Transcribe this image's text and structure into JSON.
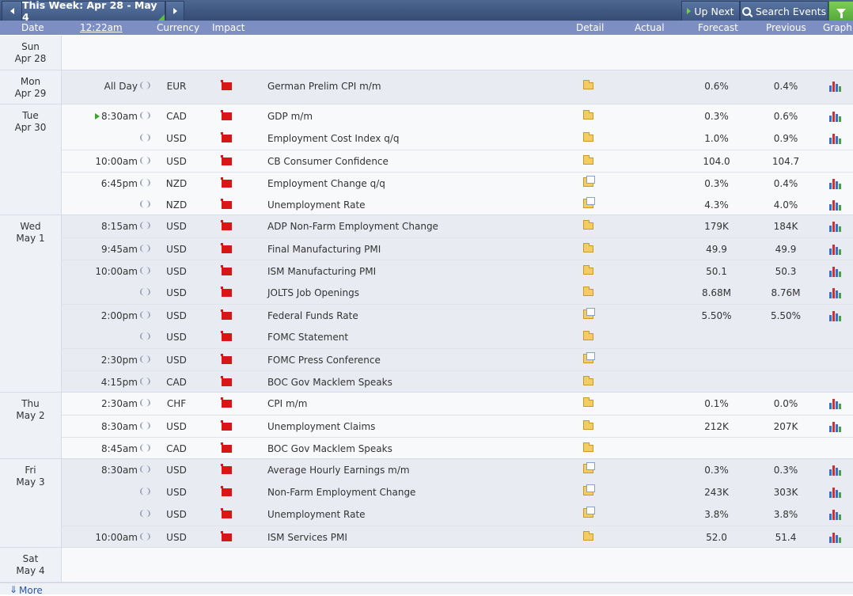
{
  "toolbar": {
    "week_label": "This Week: Apr 28 - May 4",
    "up_next": "Up Next",
    "search": "Search Events"
  },
  "header": {
    "date": "Date",
    "time": "12:22am",
    "currency": "Currency",
    "impact": "Impact",
    "detail": "Detail",
    "actual": "Actual",
    "forecast": "Forecast",
    "previous": "Previous",
    "graph": "Graph"
  },
  "days": [
    {
      "d1": "Sun",
      "d2": "Apr 28"
    },
    {
      "d1": "Mon",
      "d2": "Apr 29"
    },
    {
      "d1": "Tue",
      "d2": "Apr 30"
    },
    {
      "d1": "Wed",
      "d2": "May 1"
    },
    {
      "d1": "Thu",
      "d2": "May 2"
    },
    {
      "d1": "Fri",
      "d2": "May 3"
    },
    {
      "d1": "Sat",
      "d2": "May 4"
    }
  ],
  "events": [
    {
      "time": "All Day",
      "cur": "EUR",
      "ev": "German Prelim CPI m/m",
      "fc": "0.6%",
      "pv": "0.4%",
      "graph": true,
      "doc": false
    },
    {
      "time": "8:30am",
      "cur": "CAD",
      "ev": "GDP m/m",
      "fc": "0.3%",
      "pv": "0.6%",
      "graph": true,
      "doc": false,
      "next": true
    },
    {
      "time": "",
      "cur": "USD",
      "ev": "Employment Cost Index q/q",
      "fc": "1.0%",
      "pv": "0.9%",
      "graph": true,
      "doc": false
    },
    {
      "time": "10:00am",
      "cur": "USD",
      "ev": "CB Consumer Confidence",
      "fc": "104.0",
      "pv": "104.7",
      "graph": false,
      "doc": false
    },
    {
      "time": "6:45pm",
      "cur": "NZD",
      "ev": "Employment Change q/q",
      "fc": "0.3%",
      "pv": "0.4%",
      "graph": true,
      "doc": true
    },
    {
      "time": "",
      "cur": "NZD",
      "ev": "Unemployment Rate",
      "fc": "4.3%",
      "pv": "4.0%",
      "graph": true,
      "doc": true
    },
    {
      "time": "8:15am",
      "cur": "USD",
      "ev": "ADP Non-Farm Employment Change",
      "fc": "179K",
      "pv": "184K",
      "graph": true,
      "doc": false
    },
    {
      "time": "9:45am",
      "cur": "USD",
      "ev": "Final Manufacturing PMI",
      "fc": "49.9",
      "pv": "49.9",
      "graph": true,
      "doc": false
    },
    {
      "time": "10:00am",
      "cur": "USD",
      "ev": "ISM Manufacturing PMI",
      "fc": "50.1",
      "pv": "50.3",
      "graph": true,
      "doc": false
    },
    {
      "time": "",
      "cur": "USD",
      "ev": "JOLTS Job Openings",
      "fc": "8.68M",
      "pv": "8.76M",
      "graph": true,
      "doc": false
    },
    {
      "time": "2:00pm",
      "cur": "USD",
      "ev": "Federal Funds Rate",
      "fc": "5.50%",
      "pv": "5.50%",
      "graph": true,
      "doc": true
    },
    {
      "time": "",
      "cur": "USD",
      "ev": "FOMC Statement",
      "fc": "",
      "pv": "",
      "graph": false,
      "doc": false
    },
    {
      "time": "2:30pm",
      "cur": "USD",
      "ev": "FOMC Press Conference",
      "fc": "",
      "pv": "",
      "graph": false,
      "doc": true
    },
    {
      "time": "4:15pm",
      "cur": "CAD",
      "ev": "BOC Gov Macklem Speaks",
      "fc": "",
      "pv": "",
      "graph": false,
      "doc": false
    },
    {
      "time": "2:30am",
      "cur": "CHF",
      "ev": "CPI m/m",
      "fc": "0.1%",
      "pv": "0.0%",
      "graph": true,
      "doc": false
    },
    {
      "time": "8:30am",
      "cur": "USD",
      "ev": "Unemployment Claims",
      "fc": "212K",
      "pv": "207K",
      "graph": true,
      "doc": false
    },
    {
      "time": "8:45am",
      "cur": "CAD",
      "ev": "BOC Gov Macklem Speaks",
      "fc": "",
      "pv": "",
      "graph": false,
      "doc": false
    },
    {
      "time": "8:30am",
      "cur": "USD",
      "ev": "Average Hourly Earnings m/m",
      "fc": "0.3%",
      "pv": "0.3%",
      "graph": true,
      "doc": true
    },
    {
      "time": "",
      "cur": "USD",
      "ev": "Non-Farm Employment Change",
      "fc": "243K",
      "pv": "303K",
      "graph": true,
      "doc": true
    },
    {
      "time": "",
      "cur": "USD",
      "ev": "Unemployment Rate",
      "fc": "3.8%",
      "pv": "3.8%",
      "graph": true,
      "doc": true
    },
    {
      "time": "10:00am",
      "cur": "USD",
      "ev": "ISM Services PMI",
      "fc": "52.0",
      "pv": "51.4",
      "graph": true,
      "doc": false
    }
  ],
  "more": "More"
}
